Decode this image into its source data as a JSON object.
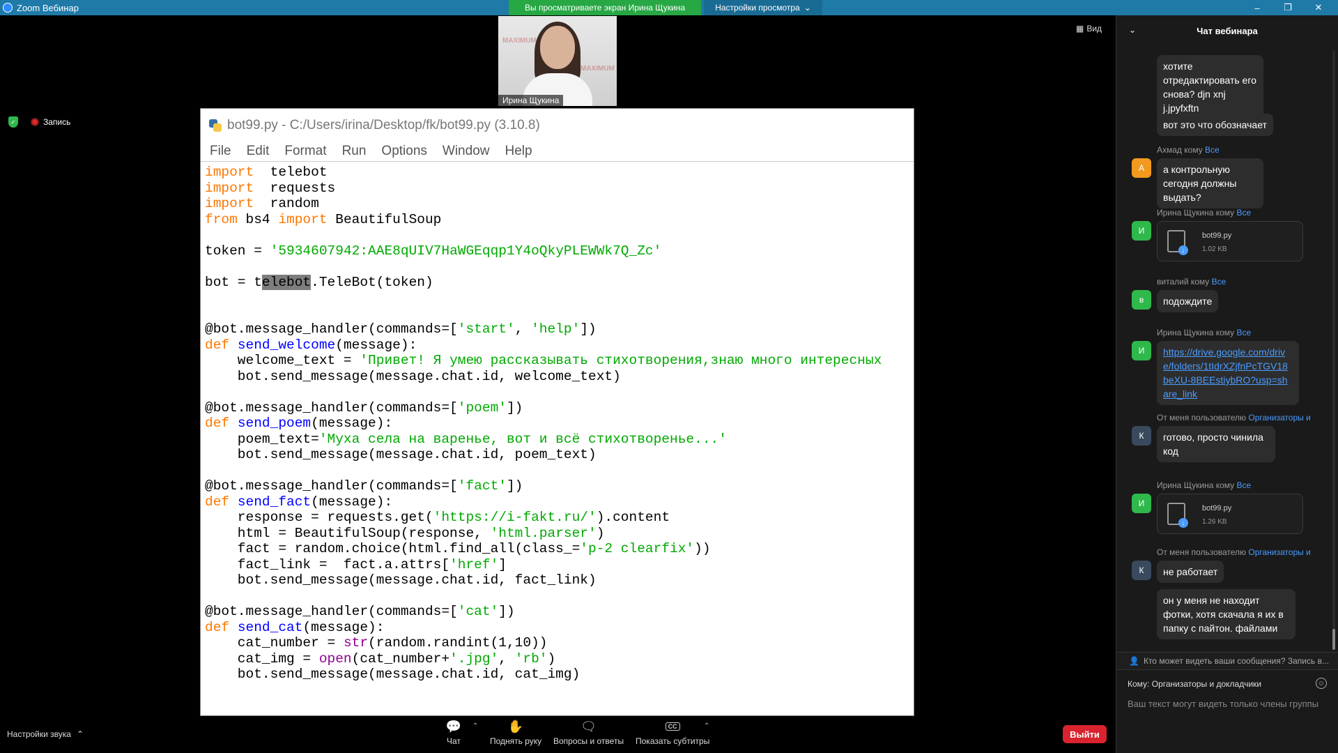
{
  "titlebar": {
    "app_name": "Zoom Вебинар",
    "minimize": "–",
    "restore": "❐",
    "close": "✕"
  },
  "share_banner": "Вы просматриваете экран Ирина Щукина",
  "view_settings": {
    "label": "Настройки просмотра",
    "caret": "⌄"
  },
  "video": {
    "name": "Ирина Щукина",
    "watermark": "MAXIMUM"
  },
  "view_button": {
    "icon": "grid-icon",
    "label": "Вид"
  },
  "recording": {
    "label": "Запись"
  },
  "idle": {
    "title": "bot99.py - C:/Users/irina/Desktop/fk/bot99.py (3.10.8)",
    "menu": [
      "File",
      "Edit",
      "Format",
      "Run",
      "Options",
      "Window",
      "Help"
    ]
  },
  "code_lines": [
    [
      [
        "kw",
        "import"
      ],
      [
        "",
        "  telebot"
      ]
    ],
    [
      [
        "kw",
        "import"
      ],
      [
        "",
        "  requests"
      ]
    ],
    [
      [
        "kw",
        "import"
      ],
      [
        "",
        "  random"
      ]
    ],
    [
      [
        "kw",
        "from"
      ],
      [
        "",
        " bs4 "
      ],
      [
        "kw",
        "import"
      ],
      [
        "",
        " BeautifulSoup"
      ]
    ],
    [],
    [
      [
        "",
        "token = "
      ],
      [
        "str",
        "'5934607942:AAE8qUIV7HaWGEqqp1Y4oQkyPLEWWk7Q_Zc'"
      ]
    ],
    [],
    [
      [
        "",
        "bot = t"
      ],
      [
        "sel",
        "elebot"
      ],
      [
        "",
        ".TeleBot(token)"
      ]
    ],
    [],
    [],
    [
      [
        "",
        "@bot.message_handler(commands=["
      ],
      [
        "str",
        "'start'"
      ],
      [
        "",
        ", "
      ],
      [
        "str",
        "'help'"
      ],
      [
        "",
        "])"
      ]
    ],
    [
      [
        "kw",
        "def"
      ],
      [
        "",
        " "
      ],
      [
        "fn",
        "send_welcome"
      ],
      [
        "",
        "(message):"
      ]
    ],
    [
      [
        "",
        "    welcome_text = "
      ],
      [
        "str",
        "'Привет! Я умею рассказывать стихотворения,знаю много интересных"
      ]
    ],
    [
      [
        "",
        "    bot.send_message(message.chat.id, welcome_text)"
      ]
    ],
    [],
    [
      [
        "",
        "@bot.message_handler(commands=["
      ],
      [
        "str",
        "'poem'"
      ],
      [
        "",
        "])"
      ]
    ],
    [
      [
        "kw",
        "def"
      ],
      [
        "",
        " "
      ],
      [
        "fn",
        "send_poem"
      ],
      [
        "",
        "(message):"
      ]
    ],
    [
      [
        "",
        "    poem_text="
      ],
      [
        "str",
        "'Муха села на варенье, вот и всё стихотворенье...'"
      ]
    ],
    [
      [
        "",
        "    bot.send_message(message.chat.id, poem_text)"
      ]
    ],
    [],
    [
      [
        "",
        "@bot.message_handler(commands=["
      ],
      [
        "str",
        "'fact'"
      ],
      [
        "",
        "])"
      ]
    ],
    [
      [
        "kw",
        "def"
      ],
      [
        "",
        " "
      ],
      [
        "fn",
        "send_fact"
      ],
      [
        "",
        "(message):"
      ]
    ],
    [
      [
        "",
        "    response = requests.get("
      ],
      [
        "str",
        "'https://i-fakt.ru/'"
      ],
      [
        "",
        ").content"
      ]
    ],
    [
      [
        "",
        "    html = BeautifulSoup(response, "
      ],
      [
        "str",
        "'html.parser'"
      ],
      [
        "",
        ")"
      ]
    ],
    [
      [
        "",
        "    fact = random.choice(html.find_all(class_="
      ],
      [
        "str",
        "'p-2 clearfix'"
      ],
      [
        "",
        "))"
      ]
    ],
    [
      [
        "",
        "    fact_link =  fact.a.attrs["
      ],
      [
        "str",
        "'href'"
      ],
      [
        "",
        "]"
      ]
    ],
    [
      [
        "",
        "    bot.send_message(message.chat.id, fact_link)"
      ]
    ],
    [],
    [
      [
        "",
        "@bot.message_handler(commands=["
      ],
      [
        "str",
        "'cat'"
      ],
      [
        "",
        "])"
      ]
    ],
    [
      [
        "kw",
        "def"
      ],
      [
        "",
        " "
      ],
      [
        "fn",
        "send_cat"
      ],
      [
        "",
        "(message):"
      ]
    ],
    [
      [
        "",
        "    cat_number = "
      ],
      [
        "bi",
        "str"
      ],
      [
        "",
        "(random.randint(1,10))"
      ]
    ],
    [
      [
        "",
        "    cat_img = "
      ],
      [
        "bi",
        "open"
      ],
      [
        "",
        "(cat_number+"
      ],
      [
        "str",
        "'.jpg'"
      ],
      [
        "",
        ", "
      ],
      [
        "str",
        "'rb'"
      ],
      [
        "",
        ")"
      ]
    ],
    [
      [
        "",
        "    bot.send_message(message.chat.id, cat_img)"
      ]
    ]
  ],
  "chat": {
    "header": "Чат вебинара",
    "collapse_icon": "chevron-down-icon",
    "messages": {
      "m1": "хотите отредактировать его снова?   djn xnj j.jpyfxftn",
      "m2": "вот это что обозначает",
      "s3": {
        "name": "Ахмад кому ",
        "to": "Все",
        "avatar": "А",
        "avatar_color": "#f29a1f"
      },
      "m3": "а контрольную сегодня должны выдать?",
      "s4": {
        "name": "Ирина Щукина кому ",
        "to": "Все",
        "avatar": "И",
        "avatar_color": "#2fb84b"
      },
      "f4": {
        "name": "bot99.py",
        "size": "1.02 KB"
      },
      "s5": {
        "name": "виталий кому ",
        "to": "Все",
        "avatar": "в",
        "avatar_color": "#2fb84b"
      },
      "m5": "подождите",
      "s6": {
        "name": "Ирина Щукина кому ",
        "to": "Все",
        "avatar": "И",
        "avatar_color": "#2fb84b"
      },
      "m6": "https://drive.google.com/drive/folders/1tIdrXZjfnPcTGV18beXU-8BEEstiybRO?usp=share_link",
      "s7": {
        "name": "От меня пользователю ",
        "to": "Организаторы и",
        "avatar": "К",
        "avatar_color": "#3a4a5e"
      },
      "m7": "готово, просто чинила код",
      "s8": {
        "name": "Ирина Щукина кому ",
        "to": "Все",
        "avatar": "И",
        "avatar_color": "#2fb84b"
      },
      "f8": {
        "name": "bot99.py",
        "size": "1.26 KB"
      },
      "s9": {
        "name": "От меня пользователю ",
        "to": "Организаторы и",
        "avatar": "К",
        "avatar_color": "#3a4a5e"
      },
      "m9": "не работает",
      "m10": "он у меня не находит фотки, хотя скачала я их в папку с пайтон. файлами"
    },
    "who_can_see": "Кто может видеть ваши сообщения? Запись в...",
    "to_label": "Кому:",
    "to_value": "Организаторы и докладчики",
    "input_hint": "Ваш текст могут видеть только члены группы"
  },
  "toolbar": {
    "sound": "Настройки звука",
    "chat": "Чат",
    "raise_hand": "Поднять руку",
    "qa": "Вопросы и ответы",
    "captions": "Показать субтитры",
    "cc": "CC",
    "leave": "Выйти"
  }
}
